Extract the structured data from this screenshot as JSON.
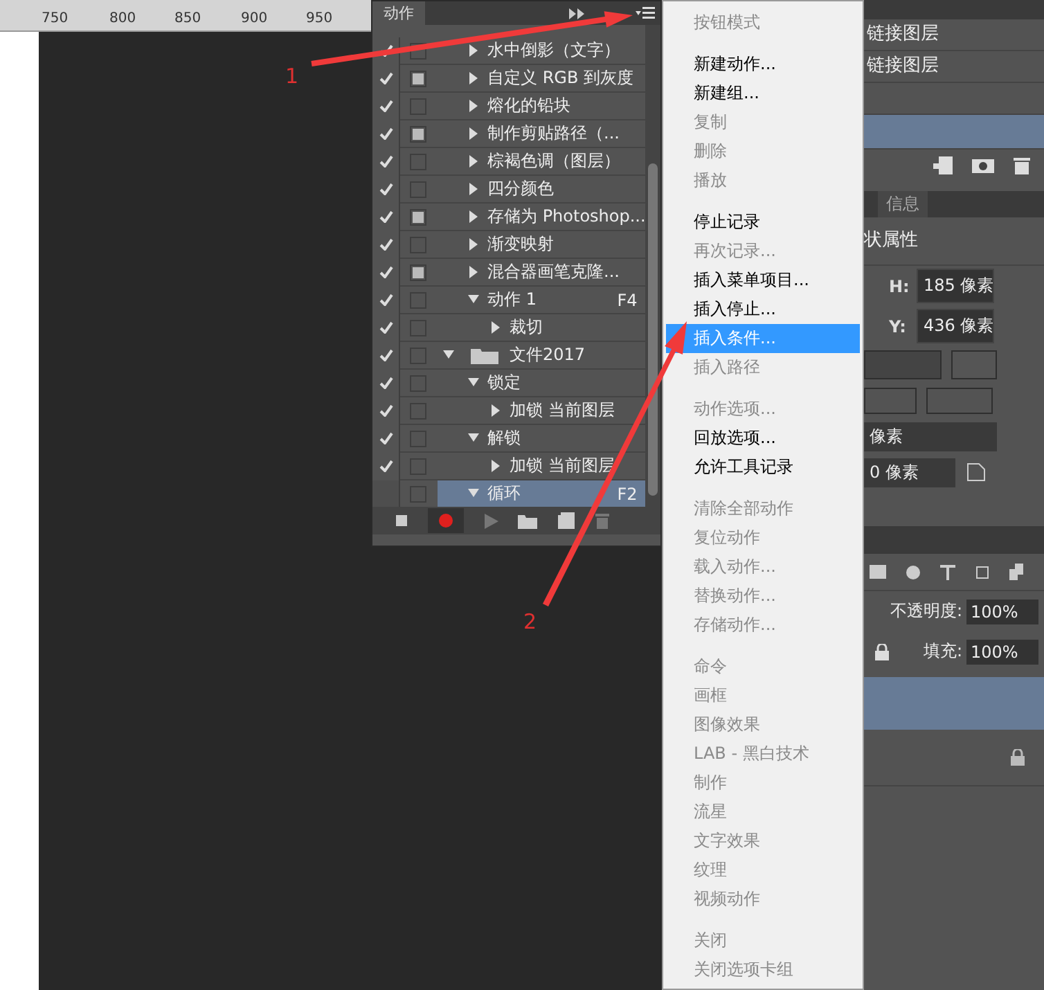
{
  "ruler": {
    "labels": [
      "750",
      "800",
      "850",
      "900",
      "950"
    ]
  },
  "actions_panel": {
    "tab": "动作",
    "items": [
      {
        "kind": "action",
        "name": "水中倒影（文字）",
        "checked": true,
        "dialog": false,
        "expanded": false
      },
      {
        "kind": "action",
        "name": "自定义 RGB 到灰度",
        "checked": true,
        "dialog": true,
        "expanded": false
      },
      {
        "kind": "action",
        "name": "熔化的铅块",
        "checked": true,
        "dialog": false,
        "expanded": false
      },
      {
        "kind": "action",
        "name": "制作剪贴路径（...",
        "checked": true,
        "dialog": true,
        "expanded": false
      },
      {
        "kind": "action",
        "name": "棕褐色调（图层）",
        "checked": true,
        "dialog": false,
        "expanded": false
      },
      {
        "kind": "action",
        "name": "四分颜色",
        "checked": true,
        "dialog": false,
        "expanded": false
      },
      {
        "kind": "action",
        "name": "存储为 Photoshop...",
        "checked": true,
        "dialog": true,
        "expanded": false
      },
      {
        "kind": "action",
        "name": "渐变映射",
        "checked": true,
        "dialog": false,
        "expanded": false
      },
      {
        "kind": "action",
        "name": "混合器画笔克隆...",
        "checked": true,
        "dialog": true,
        "expanded": false
      },
      {
        "kind": "action",
        "name": "动作 1",
        "shortcut": "F4",
        "checked": true,
        "dialog": false,
        "expanded": true,
        "children": [
          {
            "kind": "step",
            "name": "裁切",
            "checked": true,
            "dialog": false,
            "expanded": false
          }
        ]
      },
      {
        "kind": "set",
        "name": "文件2017",
        "checked": true,
        "dialog": false,
        "expanded": true,
        "children": [
          {
            "kind": "action",
            "name": "锁定",
            "checked": true,
            "dialog": false,
            "expanded": true,
            "children": [
              {
                "kind": "step",
                "name": "加锁 当前图层",
                "checked": true,
                "dialog": false,
                "expanded": false
              }
            ]
          },
          {
            "kind": "action",
            "name": "解锁",
            "checked": true,
            "dialog": false,
            "expanded": true,
            "children": [
              {
                "kind": "step",
                "name": "加锁 当前图层",
                "checked": true,
                "dialog": false,
                "expanded": false
              }
            ]
          },
          {
            "kind": "action",
            "name": "循环",
            "shortcut": "F2",
            "checked": false,
            "dialog": false,
            "expanded": true,
            "selected": true
          }
        ]
      }
    ]
  },
  "menu": [
    {
      "kind": "item",
      "label": "按钮模式",
      "disabled": true,
      "selected": false
    },
    {
      "kind": "separator"
    },
    {
      "kind": "item",
      "label": "新建动作...",
      "disabled": false,
      "selected": false
    },
    {
      "kind": "item",
      "label": "新建组...",
      "disabled": false,
      "selected": false
    },
    {
      "kind": "item",
      "label": "复制",
      "disabled": true,
      "selected": false
    },
    {
      "kind": "item",
      "label": "删除",
      "disabled": true,
      "selected": false
    },
    {
      "kind": "item",
      "label": "播放",
      "disabled": true,
      "selected": false
    },
    {
      "kind": "separator"
    },
    {
      "kind": "item",
      "label": "停止记录",
      "disabled": false,
      "selected": false
    },
    {
      "kind": "item",
      "label": "再次记录...",
      "disabled": true,
      "selected": false
    },
    {
      "kind": "item",
      "label": "插入菜单项目...",
      "disabled": false,
      "selected": false
    },
    {
      "kind": "item",
      "label": "插入停止...",
      "disabled": false,
      "selected": false
    },
    {
      "kind": "item",
      "label": "插入条件...",
      "disabled": false,
      "selected": true
    },
    {
      "kind": "item",
      "label": "插入路径",
      "disabled": true,
      "selected": false
    },
    {
      "kind": "separator"
    },
    {
      "kind": "item",
      "label": "动作选项...",
      "disabled": true,
      "selected": false
    },
    {
      "kind": "item",
      "label": "回放选项...",
      "disabled": false,
      "selected": false
    },
    {
      "kind": "item",
      "label": "允许工具记录",
      "disabled": false,
      "selected": false
    },
    {
      "kind": "separator"
    },
    {
      "kind": "item",
      "label": "清除全部动作",
      "disabled": true,
      "selected": false
    },
    {
      "kind": "item",
      "label": "复位动作",
      "disabled": true,
      "selected": false
    },
    {
      "kind": "item",
      "label": "载入动作...",
      "disabled": true,
      "selected": false
    },
    {
      "kind": "item",
      "label": "替换动作...",
      "disabled": true,
      "selected": false
    },
    {
      "kind": "item",
      "label": "存储动作...",
      "disabled": true,
      "selected": false
    },
    {
      "kind": "separator"
    },
    {
      "kind": "item",
      "label": "命令",
      "disabled": true,
      "selected": false
    },
    {
      "kind": "item",
      "label": "画框",
      "disabled": true,
      "selected": false
    },
    {
      "kind": "item",
      "label": "图像效果",
      "disabled": true,
      "selected": false
    },
    {
      "kind": "item",
      "label": "LAB - 黑白技术",
      "disabled": true,
      "selected": false
    },
    {
      "kind": "item",
      "label": "制作",
      "disabled": true,
      "selected": false
    },
    {
      "kind": "item",
      "label": "流星",
      "disabled": true,
      "selected": false
    },
    {
      "kind": "item",
      "label": "文字效果",
      "disabled": true,
      "selected": false
    },
    {
      "kind": "item",
      "label": "纹理",
      "disabled": true,
      "selected": false
    },
    {
      "kind": "item",
      "label": "视频动作",
      "disabled": true,
      "selected": false
    },
    {
      "kind": "separator"
    },
    {
      "kind": "item",
      "label": "关闭",
      "disabled": true,
      "selected": false
    },
    {
      "kind": "item",
      "label": "关闭选项卡组",
      "disabled": true,
      "selected": false
    }
  ],
  "history": {
    "rows": [
      {
        "name": "链接图层",
        "selected": false
      },
      {
        "name": "链接图层",
        "selected": false
      },
      {
        "selected": false
      },
      {
        "selected": true
      }
    ]
  },
  "properties": {
    "tab": "信息",
    "title": "状属性",
    "h_label": "H:",
    "h_value": "185 像素",
    "y_label": "Y:",
    "y_value": "436 像素",
    "field_a": "像素",
    "field_b": "0 像素"
  },
  "layers": {
    "opacity_label": "不透明度:",
    "opacity": "100%",
    "fill_label": "填充:",
    "fill": "100%"
  },
  "annotations": [
    {
      "label": "1"
    },
    {
      "label": "2"
    }
  ]
}
